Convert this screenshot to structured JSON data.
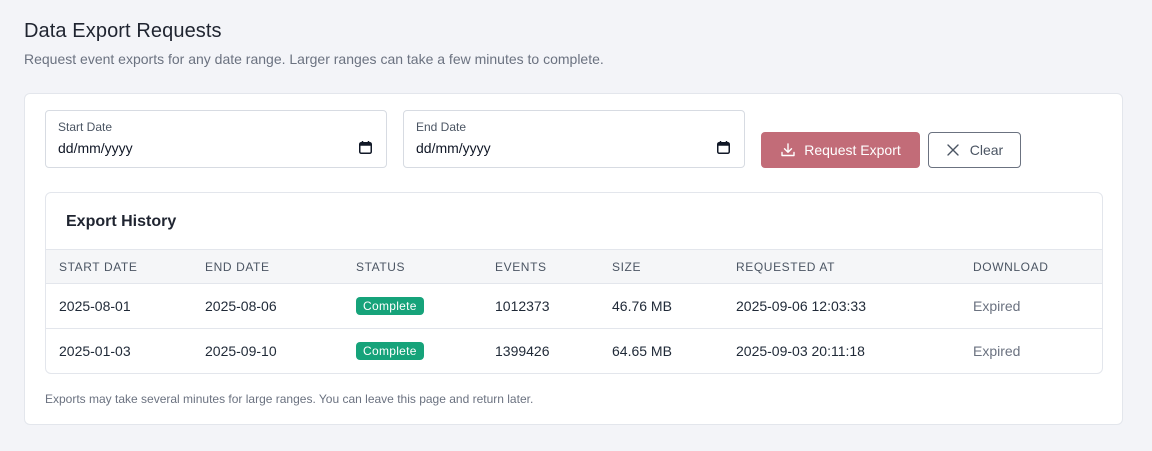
{
  "header": {
    "title": "Data Export Requests",
    "subtitle": "Request event exports for any date range. Larger ranges can take a few minutes to complete."
  },
  "form": {
    "start_date": {
      "label": "Start Date",
      "value": "dd/mm/yyyy"
    },
    "end_date": {
      "label": "End Date",
      "value": "dd/mm/yyyy"
    },
    "request_export_label": "Request Export",
    "clear_label": "Clear"
  },
  "history": {
    "title": "Export History",
    "columns": [
      "START DATE",
      "END DATE",
      "STATUS",
      "EVENTS",
      "SIZE",
      "REQUESTED AT",
      "DOWNLOAD"
    ],
    "rows": [
      {
        "start": "2025-08-01",
        "end": "2025-08-06",
        "status": "Complete",
        "events": "1012373",
        "size": "46.76 MB",
        "requested_at": "2025-09-06 12:03:33",
        "download": "Expired"
      },
      {
        "start": "2025-01-03",
        "end": "2025-09-10",
        "status": "Complete",
        "events": "1399426",
        "size": "64.65 MB",
        "requested_at": "2025-09-03 20:11:18",
        "download": "Expired"
      }
    ]
  },
  "footnote": "Exports may take several minutes for large ranges. You can leave this page and return later.",
  "colors": {
    "accent": "#c26c78",
    "status_complete": "#16a37a"
  },
  "icons": {
    "calendar": "calendar-icon",
    "download": "download-icon",
    "close": "close-icon"
  }
}
